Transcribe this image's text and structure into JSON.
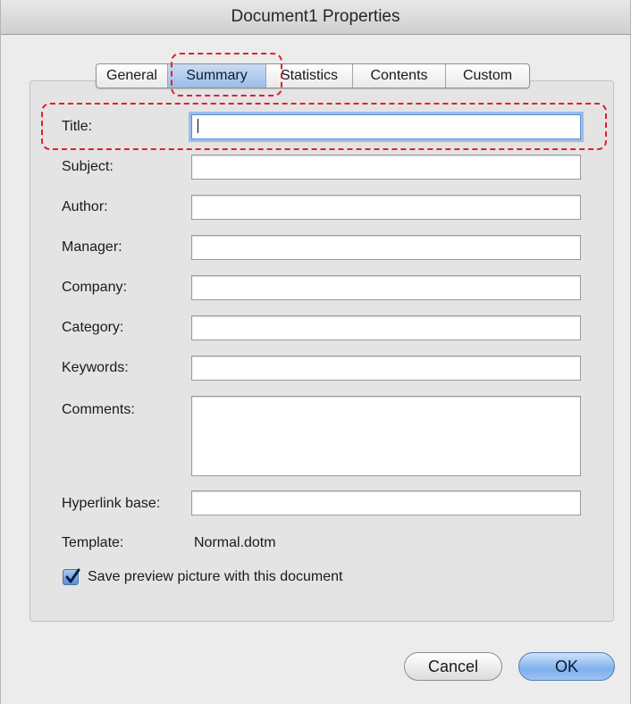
{
  "window": {
    "title": "Document1 Properties"
  },
  "tabs": [
    {
      "label": "General",
      "active": false
    },
    {
      "label": "Summary",
      "active": true
    },
    {
      "label": "Statistics",
      "active": false
    },
    {
      "label": "Contents",
      "active": false
    },
    {
      "label": "Custom",
      "active": false
    }
  ],
  "fields": {
    "title": {
      "label": "Title:",
      "value": ""
    },
    "subject": {
      "label": "Subject:",
      "value": ""
    },
    "author": {
      "label": "Author:",
      "value": ""
    },
    "manager": {
      "label": "Manager:",
      "value": ""
    },
    "company": {
      "label": "Company:",
      "value": ""
    },
    "category": {
      "label": "Category:",
      "value": ""
    },
    "keywords": {
      "label": "Keywords:",
      "value": ""
    },
    "comments": {
      "label": "Comments:",
      "value": ""
    },
    "hyperlink_base": {
      "label": "Hyperlink base:",
      "value": ""
    }
  },
  "template": {
    "label": "Template:",
    "value": "Normal.dotm"
  },
  "save_preview": {
    "label": "Save preview picture with this document",
    "checked": true
  },
  "buttons": {
    "cancel": "Cancel",
    "ok": "OK"
  },
  "colors": {
    "highlight": "#e0212b",
    "focus_ring": "#9cbde8",
    "active_tab": "#9cbde6",
    "default_button": "#7fb0ec"
  },
  "icons": {
    "checkbox": "checkmark-icon"
  }
}
